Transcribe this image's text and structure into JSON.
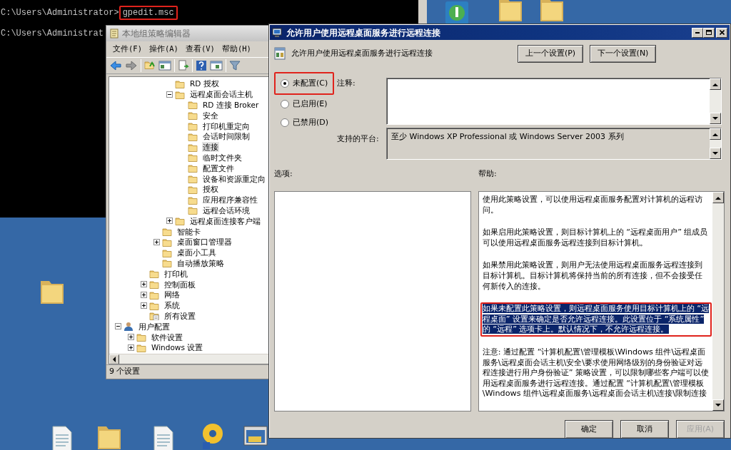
{
  "console": {
    "lines": [
      {
        "prompt": "C:\\Users\\Administrator>",
        "command": "gpedit.msc",
        "annotated": true
      },
      {
        "prompt": "C:\\Users\\Administrat"
      }
    ]
  },
  "editor": {
    "title": "本地组策略编辑器",
    "menu": [
      "文件(F)",
      "操作(A)",
      "查看(V)",
      "帮助(H)"
    ],
    "tree": [
      {
        "children": [
          {
            "children": [
              {
                "children": [
                  {
                    "children": [
                      {
                        "label": "RD 授权",
                        "kind": "folder",
                        "selected": false
                      },
                      {
                        "label": "远程桌面会话主机",
                        "kind": "folder",
                        "selected": false,
                        "expanded": true,
                        "children": [
                          {
                            "label": "RD 连接 Broker",
                            "kind": "folder",
                            "selected": false
                          },
                          {
                            "label": "安全",
                            "kind": "folder",
                            "selected": false
                          },
                          {
                            "label": "打印机重定向",
                            "kind": "folder",
                            "selected": false
                          },
                          {
                            "label": "会话时间限制",
                            "kind": "folder",
                            "selected": false
                          },
                          {
                            "label": "连接",
                            "kind": "folder",
                            "selected": true
                          },
                          {
                            "label": "临时文件夹",
                            "kind": "folder",
                            "selected": false
                          },
                          {
                            "label": "配置文件",
                            "kind": "folder",
                            "selected": false
                          },
                          {
                            "label": "设备和资源重定向",
                            "kind": "folder",
                            "selected": false
                          },
                          {
                            "label": "授权",
                            "kind": "folder",
                            "selected": false
                          },
                          {
                            "label": "应用程序兼容性",
                            "kind": "folder",
                            "selected": false
                          },
                          {
                            "label": "远程会话环境",
                            "kind": "folder",
                            "selected": false
                          }
                        ]
                      },
                      {
                        "label": "远程桌面连接客户端",
                        "kind": "folder",
                        "selected": false,
                        "expanded": false
                      }
                    ]
                  },
                  {
                    "label": "智能卡",
                    "kind": "folder",
                    "selected": false
                  },
                  {
                    "label": "桌面窗口管理器",
                    "kind": "folder",
                    "selected": false,
                    "expanded": false
                  },
                  {
                    "label": "桌面小工具",
                    "kind": "folder",
                    "selected": false
                  },
                  {
                    "label": "自动播放策略",
                    "kind": "folder",
                    "selected": false
                  }
                ]
              },
              {
                "label": "打印机",
                "kind": "folder",
                "selected": false
              },
              {
                "label": "控制面板",
                "kind": "folder",
                "selected": false,
                "expanded": false
              },
              {
                "label": "网络",
                "kind": "folder",
                "selected": false,
                "expanded": false
              },
              {
                "label": "系统",
                "kind": "folder",
                "selected": false,
                "expanded": false
              },
              {
                "label": "所有设置",
                "kind": "settings",
                "selected": false
              }
            ]
          }
        ]
      },
      {
        "label": "用户配置",
        "kind": "user",
        "selected": false,
        "expanded": true,
        "children": [
          {
            "label": "软件设置",
            "kind": "folder",
            "selected": false,
            "expanded": false
          },
          {
            "label": "Windows 设置",
            "kind": "folder",
            "selected": false,
            "expanded": false
          }
        ]
      }
    ],
    "status": "9 个设置"
  },
  "dialog": {
    "title": "允许用户使用远程桌面服务进行远程连接",
    "heading": "允许用户使用远程桌面服务进行远程连接",
    "nav_buttons": [
      "上一个设置(P)",
      "下一个设置(N)"
    ],
    "options": [
      {
        "label": "未配置(C)",
        "selected": true,
        "annotated": true
      },
      {
        "label": "已启用(E)",
        "selected": false,
        "annotated": false
      },
      {
        "label": "已禁用(D)",
        "selected": false,
        "annotated": false
      }
    ],
    "comment_label": "注释:",
    "platform_label": "支持的平台:",
    "platform": "至少 Windows XP Professional 或 Windows Server 2003 系列",
    "options_label": "选项:",
    "help_label": "帮助:",
    "help": [
      {
        "text": "使用此策略设置，可以使用远程桌面服务配置对计算机的远程访问。",
        "selected": false,
        "annotated": false
      },
      {
        "text": "如果启用此策略设置，则目标计算机上的 “远程桌面用户” 组成员可以使用远程桌面服务远程连接到目标计算机。",
        "selected": false,
        "annotated": false
      },
      {
        "text": "如果禁用此策略设置，则用户无法使用远程桌面服务远程连接到目标计算机。目标计算机将保持当前的所有连接，但不会接受任何新传入的连接。",
        "selected": false,
        "annotated": false
      },
      {
        "text": "如果未配置此策略设置，则远程桌面服务使用目标计算机上的 “远程桌面” 设置来确定是否允许远程连接。此设置位于 “系统属性” 的 “远程” 选项卡上。默认情况下，不允许远程连接。",
        "selected": true,
        "annotated": true
      },
      {
        "text": "注意: 通过配置 “计算机配置\\管理模板\\Windows 组件\\远程桌面服务\\远程桌面会话主机\\安全\\要求使用网络级别的身份验证对远程连接进行用户身份验证” 策略设置，可以限制哪些客户端可以使用远程桌面服务进行远程连接。通过配置 “计算机配置\\管理模板\\Windows 组件\\远程桌面服务\\远程桌面会话主机\\连接\\限制连接",
        "selected": false,
        "annotated": false
      }
    ],
    "buttons": [
      {
        "label": "确定",
        "disabled": false
      },
      {
        "label": "取消",
        "disabled": false
      },
      {
        "label": "应用(A)",
        "disabled": true
      }
    ]
  }
}
